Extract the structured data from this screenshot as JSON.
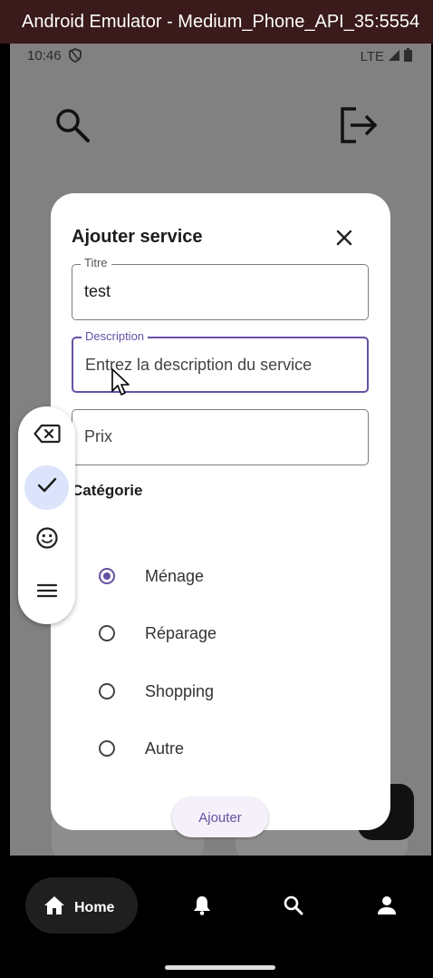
{
  "window": {
    "title": "Android Emulator - Medium_Phone_API_35:5554"
  },
  "status_bar": {
    "time": "10:46",
    "network": "LTE"
  },
  "dialog": {
    "title": "Ajouter service",
    "fields": [
      {
        "label": "Titre",
        "value": "test",
        "placeholder": ""
      },
      {
        "label": "Description",
        "value": "",
        "placeholder": "Entrez la description du service"
      },
      {
        "label": "",
        "value": "",
        "placeholder": "Prix"
      }
    ],
    "category_label": "Catégorie",
    "categories": [
      {
        "label": "Ménage",
        "selected": true
      },
      {
        "label": "Réparage",
        "selected": false
      },
      {
        "label": "Shopping",
        "selected": false
      },
      {
        "label": "Autre",
        "selected": false
      }
    ],
    "submit_label": "Ajouter"
  },
  "keyboard_toolbar": {
    "items": [
      "backspace-icon",
      "check-icon",
      "emoji-icon",
      "menu-icon"
    ],
    "active_index": 1
  },
  "bottom_nav": {
    "items": [
      {
        "icon": "home-icon",
        "label": "Home",
        "active": true
      },
      {
        "icon": "bell-icon",
        "label": "",
        "active": false
      },
      {
        "icon": "search-icon",
        "label": "",
        "active": false
      },
      {
        "icon": "person-icon",
        "label": "",
        "active": false
      }
    ]
  },
  "colors": {
    "accent": "#6750a4",
    "scrim": "#818181",
    "titlebar": "#3a1a1a"
  }
}
